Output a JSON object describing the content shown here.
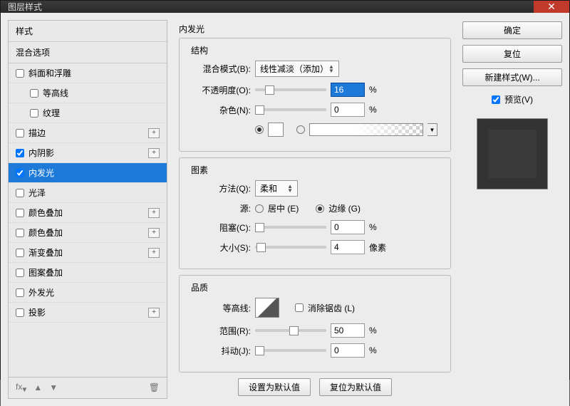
{
  "window": {
    "title": "图层样式"
  },
  "sidebar": {
    "header": "样式",
    "blending": "混合选项",
    "items": [
      {
        "label": "斜面和浮雕",
        "checked": false,
        "plus": false,
        "indent": false
      },
      {
        "label": "等高线",
        "checked": false,
        "plus": false,
        "indent": true
      },
      {
        "label": "纹理",
        "checked": false,
        "plus": false,
        "indent": true
      },
      {
        "label": "描边",
        "checked": false,
        "plus": true,
        "indent": false
      },
      {
        "label": "内阴影",
        "checked": true,
        "plus": true,
        "indent": false
      },
      {
        "label": "内发光",
        "checked": true,
        "plus": false,
        "indent": false,
        "selected": true
      },
      {
        "label": "光泽",
        "checked": false,
        "plus": false,
        "indent": false
      },
      {
        "label": "颜色叠加",
        "checked": false,
        "plus": true,
        "indent": false
      },
      {
        "label": "颜色叠加",
        "checked": false,
        "plus": true,
        "indent": false
      },
      {
        "label": "渐变叠加",
        "checked": false,
        "plus": true,
        "indent": false
      },
      {
        "label": "图案叠加",
        "checked": false,
        "plus": false,
        "indent": false
      },
      {
        "label": "外发光",
        "checked": false,
        "plus": false,
        "indent": false
      },
      {
        "label": "投影",
        "checked": false,
        "plus": true,
        "indent": false
      }
    ]
  },
  "main": {
    "title": "内发光",
    "structure": {
      "legend": "结构",
      "blendMode": {
        "label": "混合模式(B):",
        "value": "线性减淡（添加）"
      },
      "opacity": {
        "label": "不透明度(O):",
        "value": "16",
        "unit": "%"
      },
      "noise": {
        "label": "杂色(N):",
        "value": "0",
        "unit": "%"
      }
    },
    "elements": {
      "legend": "图素",
      "technique": {
        "label": "方法(Q):",
        "value": "柔和"
      },
      "source": {
        "label": "源:",
        "center": "居中 (E)",
        "edge": "边缘 (G)"
      },
      "choke": {
        "label": "阻塞(C):",
        "value": "0",
        "unit": "%"
      },
      "size": {
        "label": "大小(S):",
        "value": "4",
        "unit": "像素"
      }
    },
    "quality": {
      "legend": "品质",
      "contour": {
        "label": "等高线:",
        "anti": "消除锯齿 (L)"
      },
      "range": {
        "label": "范围(R):",
        "value": "50",
        "unit": "%"
      },
      "jitter": {
        "label": "抖动(J):",
        "value": "0",
        "unit": "%"
      }
    },
    "defaults": {
      "set": "设置为默认值",
      "reset": "复位为默认值"
    }
  },
  "right": {
    "ok": "确定",
    "cancel": "复位",
    "newStyle": "新建样式(W)...",
    "preview": "预览(V)"
  }
}
